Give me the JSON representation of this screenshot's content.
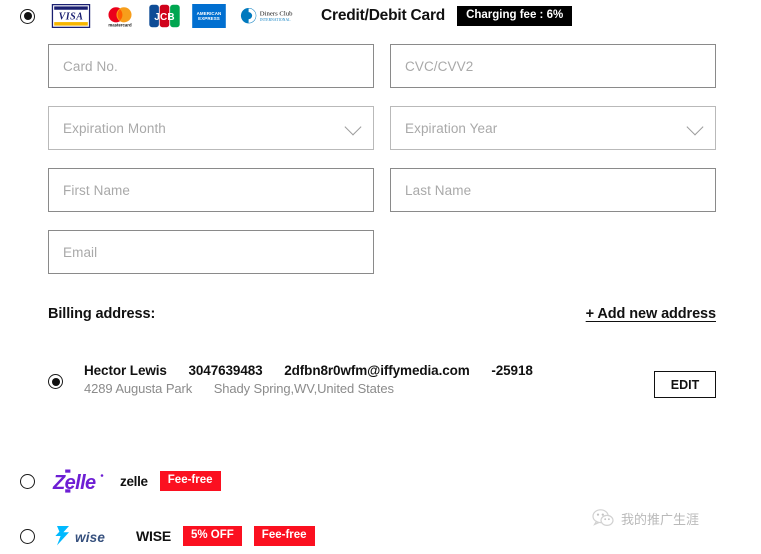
{
  "payment_method": {
    "selected": true,
    "title": "Credit/Debit Card",
    "fee_badge": "Charging fee : 6%",
    "card_brands": [
      "visa-logo",
      "mastercard-logo",
      "jcb-logo",
      "american-express-logo",
      "diners-club-logo"
    ]
  },
  "form": {
    "card_number": {
      "placeholder": "Card No.",
      "value": ""
    },
    "cvc": {
      "placeholder": "CVC/CVV2",
      "value": ""
    },
    "expiration_month": {
      "placeholder": "Expiration Month",
      "value": ""
    },
    "expiration_year": {
      "placeholder": "Expiration Year",
      "value": ""
    },
    "first_name": {
      "placeholder": "First Name",
      "value": ""
    },
    "last_name": {
      "placeholder": "Last Name",
      "value": ""
    },
    "email": {
      "placeholder": "Email",
      "value": ""
    }
  },
  "billing": {
    "label": "Billing address:",
    "add_new_label": "+ Add new address",
    "addresses": [
      {
        "selected": true,
        "name": "Hector Lewis",
        "phone": "3047639483",
        "email": "2dfbn8r0wfm@iffymedia.com",
        "zip": "-25918",
        "street": "4289 Augusta Park",
        "region": "Shady Spring,WV,United States",
        "edit_label": "EDIT"
      }
    ]
  },
  "alt_methods": [
    {
      "id": "zelle",
      "selected": false,
      "logo": "zelle-logo",
      "name": "zelle",
      "tags": [
        "Fee-free"
      ]
    },
    {
      "id": "wise",
      "selected": false,
      "logo": "wise-logo",
      "name": "WISE",
      "tags": [
        "5% OFF",
        "Fee-free"
      ]
    }
  ],
  "watermark": {
    "icon": "wechat-icon",
    "text": "我的推广生涯"
  },
  "colors": {
    "fee_badge_bg": "#000000",
    "tag_bg": "#fb1020",
    "zelle_purple": "#6D1ED4",
    "wise_blue": "#00B9FF",
    "visa_blue": "#1A1F71",
    "amex_blue": "#016FD0",
    "jcb_blue": "#0E4C96",
    "jcb_red": "#D0021B",
    "jcb_green": "#00A650",
    "mastercard_red": "#EB001B",
    "mastercard_yellow": "#F79E1B"
  }
}
